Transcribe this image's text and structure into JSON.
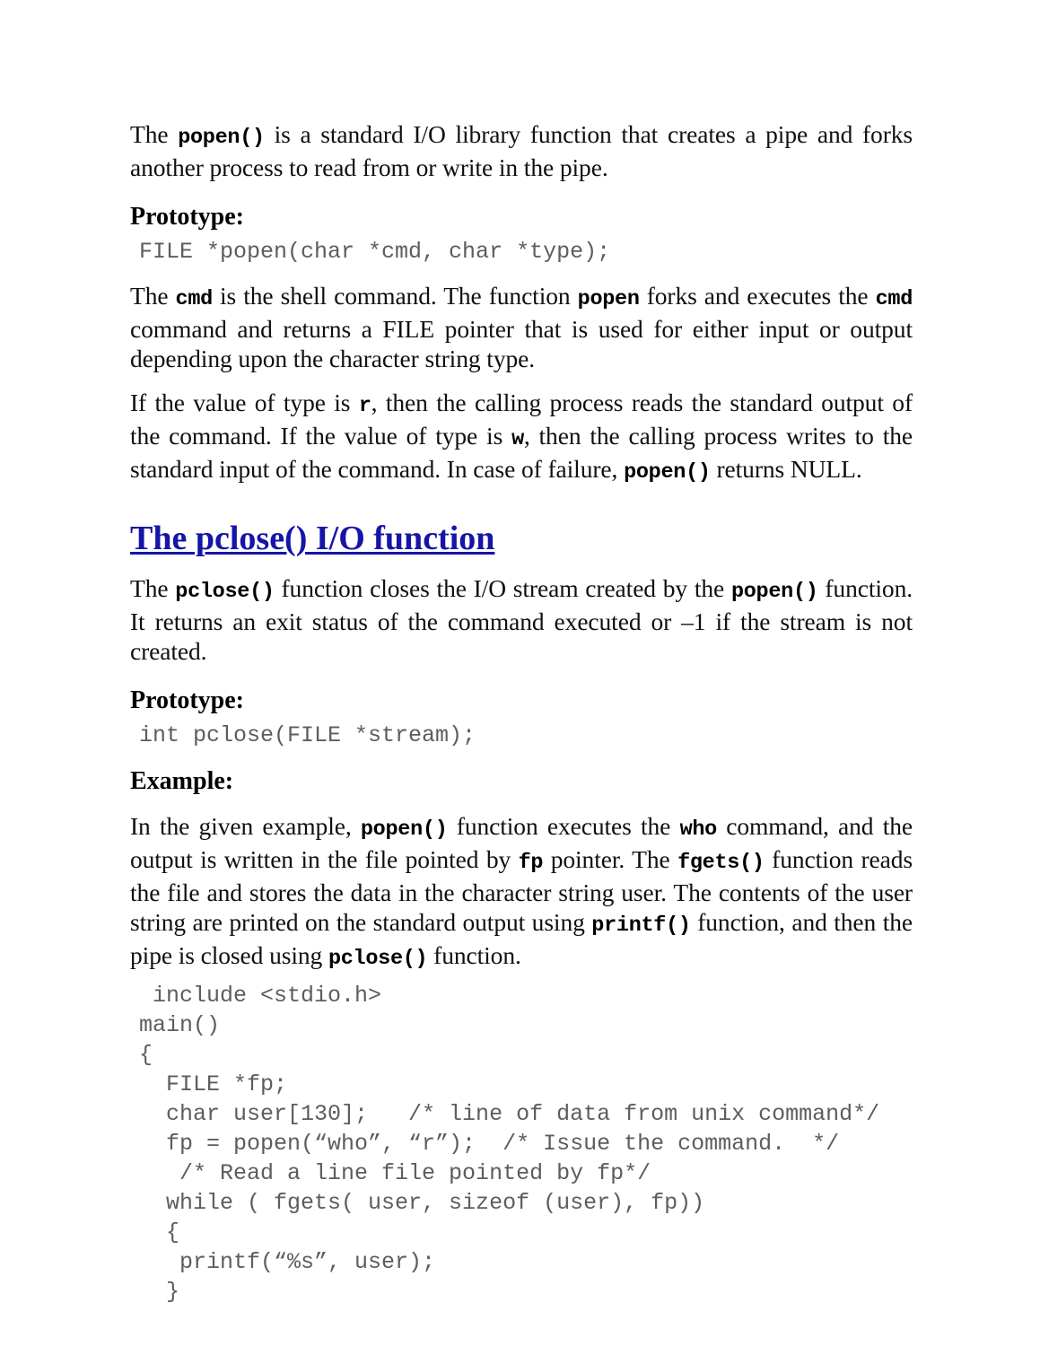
{
  "page": {
    "background_color": "#ffffff",
    "text_color": "#101010",
    "heading_color": "#1515a8",
    "code_color": "#5d5d5d"
  },
  "paragraphs": {
    "popen_intro": {
      "part1": "The ",
      "code1": "popen()",
      "part2": " is a standard I/O library function that creates a pipe and forks another process to read from or write in the pipe."
    },
    "cmd_desc": {
      "part1": "The ",
      "code1": "cmd",
      "part2": " is the shell command. The function ",
      "code2": "popen",
      "part3": " forks and executes the ",
      "code3": "cmd",
      "part4": " command and returns a FILE pointer that is used for either input or output depending upon the character string type."
    },
    "type_desc": {
      "part1": "If the value of type is ",
      "code1": "r",
      "part2": ", then the calling process reads the standard output of the command. If the value of type is ",
      "code2": "w",
      "part3": ", then the calling process writes to the standard input of the command. In case of failure, ",
      "code3": "popen()",
      "part4": " returns NULL."
    },
    "pclose_desc": {
      "part1": "The ",
      "code1": "pclose()",
      "part2": " function closes the I/O stream created by the ",
      "code2": "popen()",
      "part3": " function. It returns an exit status of the command executed or –1 if the stream is not created."
    },
    "example_desc": {
      "part1": "In the given example, ",
      "code1": "popen()",
      "part2": " function executes the ",
      "code2": "who",
      "part3": " command, and the output is written in the file pointed by ",
      "code3": "fp",
      "part4": " pointer. The ",
      "code4": "fgets()",
      "part5": " function reads the file and stores the data in the character string user. The contents of the user string are printed on the standard output using ",
      "code5": "printf()",
      "part6": " function, and then the pipe is closed using ",
      "code6": "pclose()",
      "part7": " function."
    }
  },
  "headings": {
    "prototype_1": "Prototype:",
    "pclose_section": "The pclose() I/O function",
    "prototype_2": "Prototype:",
    "example": "Example:"
  },
  "prototypes": {
    "popen": "FILE *popen(char *cmd, char *type);",
    "pclose": "int pclose(FILE *stream);"
  },
  "code_listing": {
    "lines": [
      " include <stdio.h>",
      "main()",
      "{",
      "  FILE *fp;",
      "  char user[130];   /* line of data from unix command*/",
      "  fp = popen(“who”, “r”);  /* Issue the command.  */",
      "   /* Read a line file pointed by fp*/",
      "  while ( fgets( user, sizeof (user), fp))",
      "  {",
      "   printf(“%s”, user);",
      "  }"
    ]
  }
}
